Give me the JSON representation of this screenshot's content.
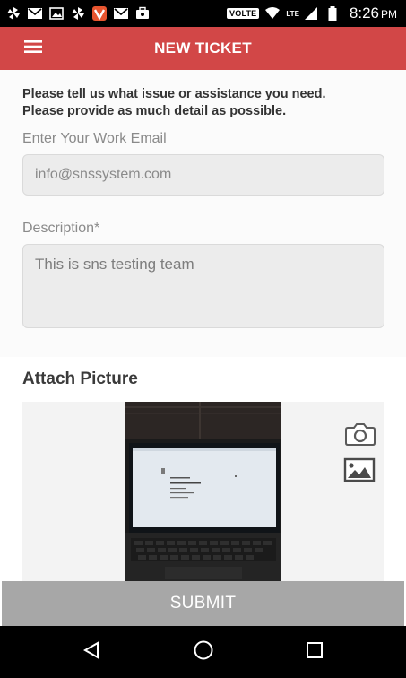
{
  "status_bar": {
    "time": "8:26",
    "ampm": "PM",
    "volte_label": "VOLTE",
    "lte_label": "LTE",
    "icons": [
      "pinwheel-icon",
      "gmail-icon",
      "image-icon",
      "pinwheel-icon",
      "vidmate-icon",
      "gmail-icon",
      "briefcase-icon",
      "wifi-icon",
      "signal-icon",
      "battery-icon"
    ]
  },
  "app_bar": {
    "title": "NEW TICKET",
    "menu_icon": "hamburger-menu-icon",
    "color": "#d24747"
  },
  "form": {
    "intro_line1": "Please tell us what issue or assistance you need.",
    "intro_line2": "Please provide as much detail as possible.",
    "email_label": "Enter Your Work Email",
    "email_value": "info@snssystem.com",
    "description_label": "Description*",
    "description_value": "This is sns testing team"
  },
  "attach": {
    "title": "Attach Picture",
    "camera_icon": "camera-icon",
    "gallery_icon": "gallery-icon"
  },
  "submit": {
    "label": "SUBMIT",
    "color": "#a7a7a7"
  },
  "nav_bar": {
    "icons": [
      "back-icon",
      "home-icon",
      "recents-icon"
    ]
  }
}
